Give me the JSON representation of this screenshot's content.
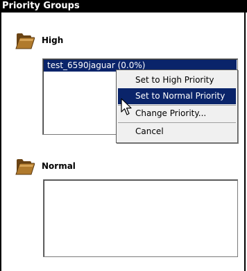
{
  "window": {
    "title": "Priority Groups"
  },
  "groups": [
    {
      "label": "High",
      "icon": "folder-icon",
      "items": [
        "test_6590jaguar (0.0%)"
      ]
    },
    {
      "label": "Normal",
      "icon": "folder-icon",
      "items": []
    }
  ],
  "context_menu": {
    "items": [
      {
        "label": "Set to High Priority"
      },
      {
        "label": "Set to Normal Priority",
        "selected": true
      },
      {
        "label": "Change Priority..."
      },
      {
        "label": "Cancel"
      }
    ]
  },
  "colors": {
    "selection": "#0a246a",
    "folder": "#8a5a1e",
    "titlebar": "#000000"
  }
}
